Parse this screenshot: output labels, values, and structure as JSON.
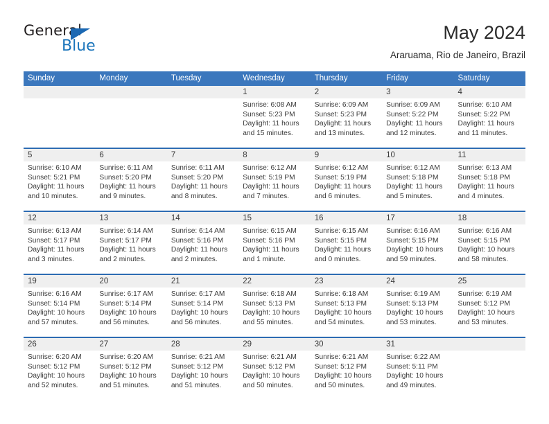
{
  "brand": {
    "name_part1": "General",
    "name_part2": "Blue",
    "accent_color": "#1b75bb",
    "triangle_color": "#1b68b3"
  },
  "header": {
    "title": "May 2024",
    "subtitle": "Araruama, Rio de Janeiro, Brazil"
  },
  "theme": {
    "header_blue": "#3b77bd",
    "row_divider_blue": "#2d6cb3",
    "daynum_band_gray": "#efefef"
  },
  "calendar": {
    "weekday_headers": [
      "Sunday",
      "Monday",
      "Tuesday",
      "Wednesday",
      "Thursday",
      "Friday",
      "Saturday"
    ],
    "weeks": [
      [
        {
          "day": "",
          "sunrise": "",
          "sunset": "",
          "daylight_line1": "",
          "daylight_line2": "",
          "empty": true
        },
        {
          "day": "",
          "sunrise": "",
          "sunset": "",
          "daylight_line1": "",
          "daylight_line2": "",
          "empty": true
        },
        {
          "day": "",
          "sunrise": "",
          "sunset": "",
          "daylight_line1": "",
          "daylight_line2": "",
          "empty": true
        },
        {
          "day": "1",
          "sunrise": "Sunrise: 6:08 AM",
          "sunset": "Sunset: 5:23 PM",
          "daylight_line1": "Daylight: 11 hours",
          "daylight_line2": "and 15 minutes.",
          "empty": false
        },
        {
          "day": "2",
          "sunrise": "Sunrise: 6:09 AM",
          "sunset": "Sunset: 5:23 PM",
          "daylight_line1": "Daylight: 11 hours",
          "daylight_line2": "and 13 minutes.",
          "empty": false
        },
        {
          "day": "3",
          "sunrise": "Sunrise: 6:09 AM",
          "sunset": "Sunset: 5:22 PM",
          "daylight_line1": "Daylight: 11 hours",
          "daylight_line2": "and 12 minutes.",
          "empty": false
        },
        {
          "day": "4",
          "sunrise": "Sunrise: 6:10 AM",
          "sunset": "Sunset: 5:22 PM",
          "daylight_line1": "Daylight: 11 hours",
          "daylight_line2": "and 11 minutes.",
          "empty": false
        }
      ],
      [
        {
          "day": "5",
          "sunrise": "Sunrise: 6:10 AM",
          "sunset": "Sunset: 5:21 PM",
          "daylight_line1": "Daylight: 11 hours",
          "daylight_line2": "and 10 minutes.",
          "empty": false
        },
        {
          "day": "6",
          "sunrise": "Sunrise: 6:11 AM",
          "sunset": "Sunset: 5:20 PM",
          "daylight_line1": "Daylight: 11 hours",
          "daylight_line2": "and 9 minutes.",
          "empty": false
        },
        {
          "day": "7",
          "sunrise": "Sunrise: 6:11 AM",
          "sunset": "Sunset: 5:20 PM",
          "daylight_line1": "Daylight: 11 hours",
          "daylight_line2": "and 8 minutes.",
          "empty": false
        },
        {
          "day": "8",
          "sunrise": "Sunrise: 6:12 AM",
          "sunset": "Sunset: 5:19 PM",
          "daylight_line1": "Daylight: 11 hours",
          "daylight_line2": "and 7 minutes.",
          "empty": false
        },
        {
          "day": "9",
          "sunrise": "Sunrise: 6:12 AM",
          "sunset": "Sunset: 5:19 PM",
          "daylight_line1": "Daylight: 11 hours",
          "daylight_line2": "and 6 minutes.",
          "empty": false
        },
        {
          "day": "10",
          "sunrise": "Sunrise: 6:12 AM",
          "sunset": "Sunset: 5:18 PM",
          "daylight_line1": "Daylight: 11 hours",
          "daylight_line2": "and 5 minutes.",
          "empty": false
        },
        {
          "day": "11",
          "sunrise": "Sunrise: 6:13 AM",
          "sunset": "Sunset: 5:18 PM",
          "daylight_line1": "Daylight: 11 hours",
          "daylight_line2": "and 4 minutes.",
          "empty": false
        }
      ],
      [
        {
          "day": "12",
          "sunrise": "Sunrise: 6:13 AM",
          "sunset": "Sunset: 5:17 PM",
          "daylight_line1": "Daylight: 11 hours",
          "daylight_line2": "and 3 minutes.",
          "empty": false
        },
        {
          "day": "13",
          "sunrise": "Sunrise: 6:14 AM",
          "sunset": "Sunset: 5:17 PM",
          "daylight_line1": "Daylight: 11 hours",
          "daylight_line2": "and 2 minutes.",
          "empty": false
        },
        {
          "day": "14",
          "sunrise": "Sunrise: 6:14 AM",
          "sunset": "Sunset: 5:16 PM",
          "daylight_line1": "Daylight: 11 hours",
          "daylight_line2": "and 2 minutes.",
          "empty": false
        },
        {
          "day": "15",
          "sunrise": "Sunrise: 6:15 AM",
          "sunset": "Sunset: 5:16 PM",
          "daylight_line1": "Daylight: 11 hours",
          "daylight_line2": "and 1 minute.",
          "empty": false
        },
        {
          "day": "16",
          "sunrise": "Sunrise: 6:15 AM",
          "sunset": "Sunset: 5:15 PM",
          "daylight_line1": "Daylight: 11 hours",
          "daylight_line2": "and 0 minutes.",
          "empty": false
        },
        {
          "day": "17",
          "sunrise": "Sunrise: 6:16 AM",
          "sunset": "Sunset: 5:15 PM",
          "daylight_line1": "Daylight: 10 hours",
          "daylight_line2": "and 59 minutes.",
          "empty": false
        },
        {
          "day": "18",
          "sunrise": "Sunrise: 6:16 AM",
          "sunset": "Sunset: 5:15 PM",
          "daylight_line1": "Daylight: 10 hours",
          "daylight_line2": "and 58 minutes.",
          "empty": false
        }
      ],
      [
        {
          "day": "19",
          "sunrise": "Sunrise: 6:16 AM",
          "sunset": "Sunset: 5:14 PM",
          "daylight_line1": "Daylight: 10 hours",
          "daylight_line2": "and 57 minutes.",
          "empty": false
        },
        {
          "day": "20",
          "sunrise": "Sunrise: 6:17 AM",
          "sunset": "Sunset: 5:14 PM",
          "daylight_line1": "Daylight: 10 hours",
          "daylight_line2": "and 56 minutes.",
          "empty": false
        },
        {
          "day": "21",
          "sunrise": "Sunrise: 6:17 AM",
          "sunset": "Sunset: 5:14 PM",
          "daylight_line1": "Daylight: 10 hours",
          "daylight_line2": "and 56 minutes.",
          "empty": false
        },
        {
          "day": "22",
          "sunrise": "Sunrise: 6:18 AM",
          "sunset": "Sunset: 5:13 PM",
          "daylight_line1": "Daylight: 10 hours",
          "daylight_line2": "and 55 minutes.",
          "empty": false
        },
        {
          "day": "23",
          "sunrise": "Sunrise: 6:18 AM",
          "sunset": "Sunset: 5:13 PM",
          "daylight_line1": "Daylight: 10 hours",
          "daylight_line2": "and 54 minutes.",
          "empty": false
        },
        {
          "day": "24",
          "sunrise": "Sunrise: 6:19 AM",
          "sunset": "Sunset: 5:13 PM",
          "daylight_line1": "Daylight: 10 hours",
          "daylight_line2": "and 53 minutes.",
          "empty": false
        },
        {
          "day": "25",
          "sunrise": "Sunrise: 6:19 AM",
          "sunset": "Sunset: 5:12 PM",
          "daylight_line1": "Daylight: 10 hours",
          "daylight_line2": "and 53 minutes.",
          "empty": false
        }
      ],
      [
        {
          "day": "26",
          "sunrise": "Sunrise: 6:20 AM",
          "sunset": "Sunset: 5:12 PM",
          "daylight_line1": "Daylight: 10 hours",
          "daylight_line2": "and 52 minutes.",
          "empty": false
        },
        {
          "day": "27",
          "sunrise": "Sunrise: 6:20 AM",
          "sunset": "Sunset: 5:12 PM",
          "daylight_line1": "Daylight: 10 hours",
          "daylight_line2": "and 51 minutes.",
          "empty": false
        },
        {
          "day": "28",
          "sunrise": "Sunrise: 6:21 AM",
          "sunset": "Sunset: 5:12 PM",
          "daylight_line1": "Daylight: 10 hours",
          "daylight_line2": "and 51 minutes.",
          "empty": false
        },
        {
          "day": "29",
          "sunrise": "Sunrise: 6:21 AM",
          "sunset": "Sunset: 5:12 PM",
          "daylight_line1": "Daylight: 10 hours",
          "daylight_line2": "and 50 minutes.",
          "empty": false
        },
        {
          "day": "30",
          "sunrise": "Sunrise: 6:21 AM",
          "sunset": "Sunset: 5:12 PM",
          "daylight_line1": "Daylight: 10 hours",
          "daylight_line2": "and 50 minutes.",
          "empty": false
        },
        {
          "day": "31",
          "sunrise": "Sunrise: 6:22 AM",
          "sunset": "Sunset: 5:11 PM",
          "daylight_line1": "Daylight: 10 hours",
          "daylight_line2": "and 49 minutes.",
          "empty": false
        },
        {
          "day": "",
          "sunrise": "",
          "sunset": "",
          "daylight_line1": "",
          "daylight_line2": "",
          "empty": true
        }
      ]
    ]
  }
}
